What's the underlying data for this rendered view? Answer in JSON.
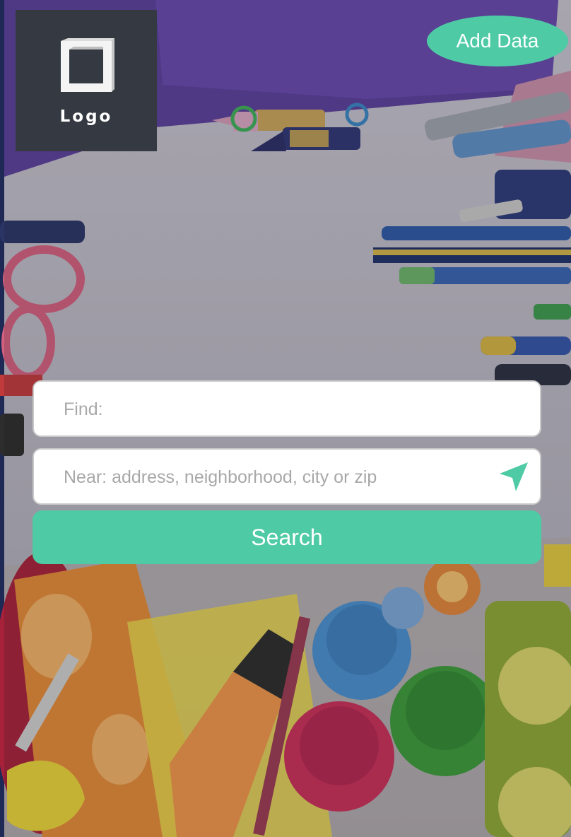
{
  "brand": {
    "logo_text": "Logo",
    "logo_icon": "square-frame-icon"
  },
  "header": {
    "add_data_label": "Add Data"
  },
  "search": {
    "find_placeholder": "Find:",
    "near_placeholder": "Near: address, neighborhood, city or zip",
    "locate_icon": "navigation-arrow-icon",
    "submit_label": "Search"
  },
  "colors": {
    "accent": "#4ecba4",
    "logo_bg": "#353a42"
  }
}
